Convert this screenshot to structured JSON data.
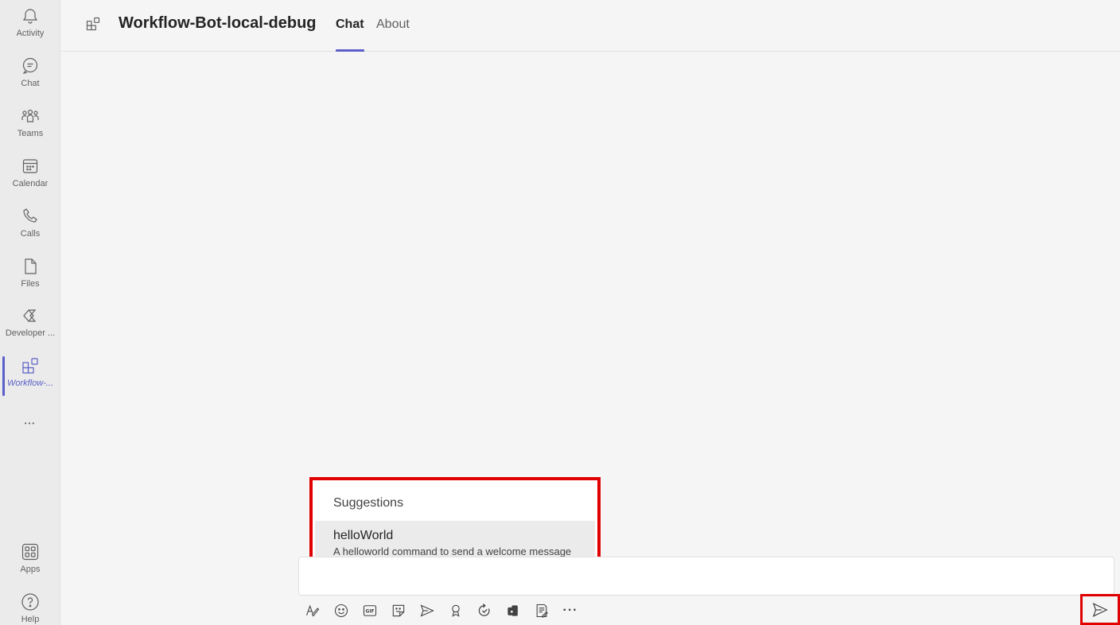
{
  "rail": {
    "items": [
      {
        "label": "Activity",
        "icon": "bell-icon"
      },
      {
        "label": "Chat",
        "icon": "chat-icon"
      },
      {
        "label": "Teams",
        "icon": "teams-icon"
      },
      {
        "label": "Calendar",
        "icon": "calendar-icon"
      },
      {
        "label": "Calls",
        "icon": "phone-icon"
      },
      {
        "label": "Files",
        "icon": "file-icon"
      },
      {
        "label": "Developer ...",
        "icon": "developer-portal-icon"
      },
      {
        "label": "Workflow-...",
        "icon": "app-grid-icon",
        "active": true
      }
    ],
    "more_label": "•••",
    "bottom": [
      {
        "label": "Apps",
        "icon": "apps-icon"
      },
      {
        "label": "Help",
        "icon": "help-icon"
      }
    ]
  },
  "header": {
    "title": "Workflow-Bot-local-debug",
    "tabs": [
      {
        "label": "Chat",
        "active": true
      },
      {
        "label": "About",
        "active": false
      }
    ]
  },
  "suggestions": {
    "heading": "Suggestions",
    "items": [
      {
        "command": "helloWorld",
        "description": "A helloworld command to send a welcome message"
      }
    ]
  },
  "compose": {
    "value": "",
    "placeholder": ""
  },
  "toolbar": {
    "more_label": "···",
    "tools": [
      "format-icon",
      "emoji-icon",
      "gif-icon",
      "sticker-icon",
      "meet-now-icon",
      "praise-icon",
      "loop-icon",
      "hand-icon",
      "notes-icon",
      "more-options-icon"
    ]
  },
  "colors": {
    "accent": "#5b5fc7",
    "highlight_border": "#e00000",
    "rail_bg": "#ebebeb",
    "page_bg": "#f5f5f5"
  }
}
